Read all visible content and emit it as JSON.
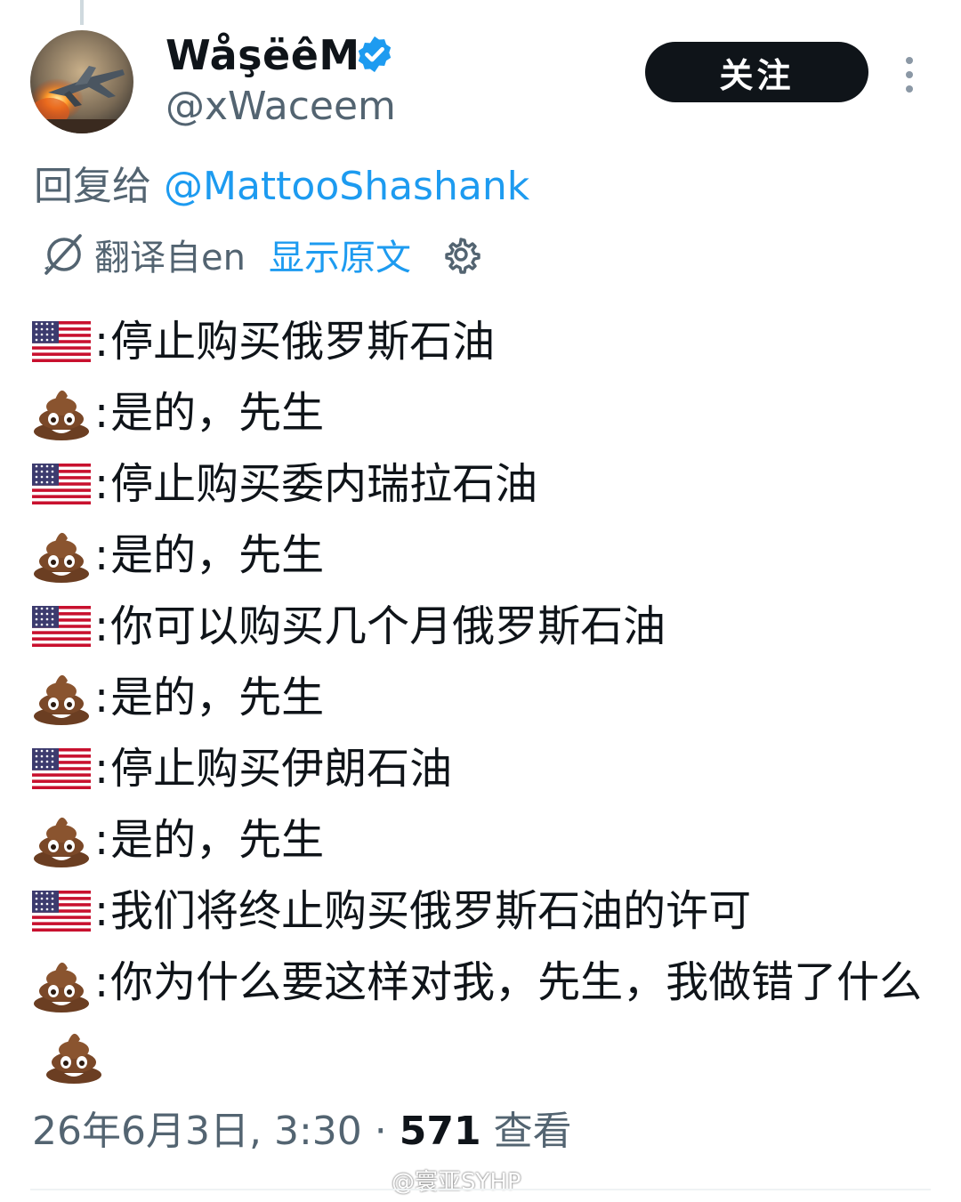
{
  "author": {
    "display_name": "WåşëêM",
    "handle": "@xWaceem",
    "verified": true,
    "avatar_icon": "fighter-jet-avatar"
  },
  "follow_button": {
    "label": "关注"
  },
  "more_icon": "more-vertical-icon",
  "reply_to": {
    "prefix": "回复给 ",
    "mention": "@MattooShashank"
  },
  "translation": {
    "translated_from": "翻译自en",
    "show_original": "显示原文",
    "settings_icon": "gear-icon"
  },
  "tweet": {
    "lines": [
      {
        "speaker": "us-flag",
        "text": "停止购买俄罗斯石油"
      },
      {
        "speaker": "poop",
        "text": "是的，先生"
      },
      {
        "speaker": "us-flag",
        "text": "停止购买委内瑞拉石油"
      },
      {
        "speaker": "poop",
        "text": "是的，先生"
      },
      {
        "speaker": "us-flag",
        "text": "你可以购买几个月俄罗斯石油"
      },
      {
        "speaker": "poop",
        "text": "是的，先生"
      },
      {
        "speaker": "us-flag",
        "text": "停止购买伊朗石油"
      },
      {
        "speaker": "poop",
        "text": "是的，先生"
      },
      {
        "speaker": "us-flag",
        "text": "我们将终止购买俄罗斯石油的许可"
      },
      {
        "speaker": "poop",
        "text": "你为什么要这样对我，先生，我做错了什么"
      }
    ],
    "separator": ":"
  },
  "meta": {
    "timestamp": "26年6月3日, 3:30",
    "dot": " · ",
    "views_count": "571",
    "views_label": " 查看"
  },
  "watermark": {
    "text": "@寰亚SYHP"
  },
  "colors": {
    "accent": "#1d9bf0",
    "text": "#0f1419",
    "muted": "#536471",
    "button": "#0f1419"
  }
}
